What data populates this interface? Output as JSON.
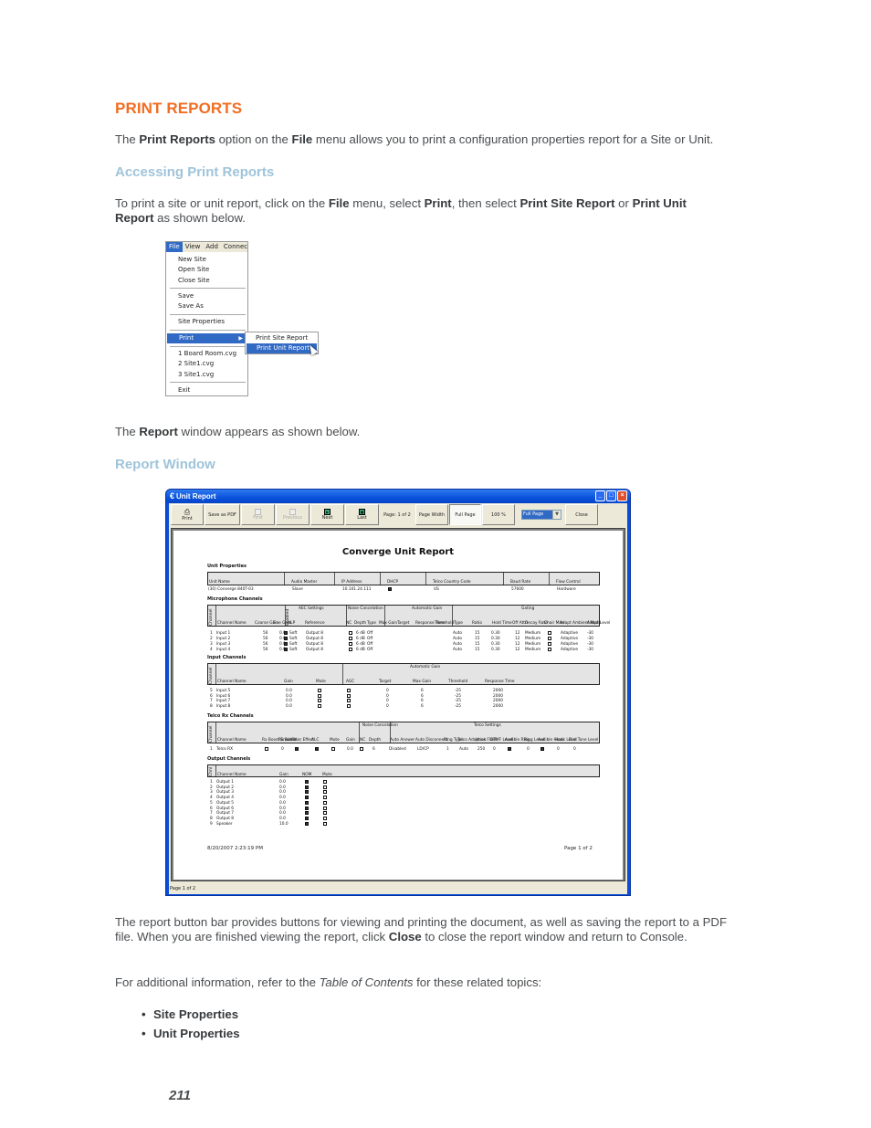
{
  "heading": "PRINT REPORTS",
  "intro": {
    "p1": "The ",
    "b1": "Print Reports",
    "p2": " option on the ",
    "b2": "File",
    "p3": " menu allows you to print a configuration properties report for a Site or Unit."
  },
  "section1": {
    "title": "Accessing Print Reports",
    "t1": "To print a site or unit report, click on the ",
    "b1": "File",
    "t2": " menu, select ",
    "b2": "Print",
    "t3": ", then select ",
    "b3": "Print Site Report",
    "t4": " or ",
    "b4": "Print Unit",
    "b5": "Report",
    "t5": " as shown below."
  },
  "file_menu": {
    "menubar": [
      "File",
      "View",
      "Add",
      "Connec"
    ],
    "groups": [
      [
        "New Site",
        "Open Site",
        "Close Site"
      ],
      [
        "Save",
        "Save As"
      ],
      [
        "Site Properties"
      ],
      [
        "Print"
      ],
      [
        "1 Board Room.cvg",
        "2 Site1.cvg",
        "3 Site1.cvg"
      ],
      [
        "Exit"
      ]
    ],
    "submenu": [
      "Print Site Report",
      "Print Unit Report"
    ],
    "highlighted_item": "Print",
    "highlighted_subitem": "Print Unit Report"
  },
  "report_caption": {
    "t1": "The ",
    "b1": "Report",
    "t2": " window appears as shown below."
  },
  "section2": {
    "title": "Report Window"
  },
  "report_window": {
    "title": "Unit Report",
    "toolbar": {
      "print": "Print",
      "save_pdf": "Save as PDF",
      "first": "First",
      "previous": "Previous",
      "next": "Next",
      "last": "Last",
      "page_indicator": "Page: 1 of 2",
      "page_width": "Page Width",
      "full_page": "Full Page",
      "zoom_percent": "100 %",
      "zoom_select": "Full Page",
      "close": "Close"
    },
    "status": "Page 1 of 2",
    "report": {
      "title": "Converge Unit Report",
      "unit_properties": {
        "label": "Unit Properties",
        "headers": [
          "Unit Name",
          "Audio Master",
          "IP Address",
          "DHCP",
          "Telco Country Code",
          "Baud Rate",
          "Flow Control"
        ],
        "row": [
          "(30) Converge 840T-03",
          "Slave",
          "10.101.24.111",
          "checked",
          "US",
          "57600",
          "Hardware"
        ]
      },
      "microphone_channels": {
        "label": "Microphone Channels",
        "group_headers": [
          "AEC Settings",
          "Noise Cancelation",
          "Automatic Gain",
          "Gating"
        ],
        "headers": [
          "Channel",
          "Channel Name",
          "Coarse Gain",
          "Fine Gain",
          "Enabled",
          "NLP",
          "Reference",
          "NC",
          "Depth",
          "Type",
          "Max Gain",
          "Target",
          "Response Time",
          "Threshold",
          "Type",
          "Ratio",
          "Hold Time",
          "Off Attn",
          "Decay Rate",
          "Chair Man",
          "Adapt Ambient Mode",
          "Adapt Level"
        ],
        "rows": [
          [
            "1",
            "Input 1",
            "56",
            "0.0",
            "on",
            "Soft",
            "Output 8",
            "off",
            "6 dB",
            "Off",
            "",
            "",
            "",
            "",
            "Auto",
            "15",
            "0.30",
            "12",
            "Medium",
            "off",
            "Adaptive",
            "-30"
          ],
          [
            "2",
            "Input 2",
            "56",
            "0.0",
            "on",
            "Soft",
            "Output 8",
            "off",
            "6 dB",
            "Off",
            "",
            "",
            "",
            "",
            "Auto",
            "15",
            "0.30",
            "12",
            "Medium",
            "off",
            "Adaptive",
            "-30"
          ],
          [
            "3",
            "Input 3",
            "56",
            "0.0",
            "on",
            "Soft",
            "Output 8",
            "off",
            "6 dB",
            "Off",
            "",
            "",
            "",
            "",
            "Auto",
            "15",
            "0.30",
            "12",
            "Medium",
            "off",
            "Adaptive",
            "-30"
          ],
          [
            "4",
            "Input 4",
            "56",
            "0.0",
            "on",
            "Soft",
            "Output 8",
            "off",
            "6 dB",
            "Off",
            "",
            "",
            "",
            "",
            "Auto",
            "15",
            "0.30",
            "12",
            "Medium",
            "off",
            "Adaptive",
            "-30"
          ]
        ]
      },
      "input_channels": {
        "label": "Input Channels",
        "group_header": "Automatic Gain",
        "headers": [
          "Channel",
          "Channel Name",
          "Gain",
          "Mute",
          "AGC",
          "Target",
          "Max Gain",
          "Threshold",
          "Response Time"
        ],
        "rows": [
          [
            "5",
            "Input 5",
            "0.0",
            "off",
            "off",
            "0",
            "6",
            "-25",
            "2000"
          ],
          [
            "6",
            "Input 6",
            "0.0",
            "off",
            "off",
            "0",
            "6",
            "-25",
            "2000"
          ],
          [
            "7",
            "Input 7",
            "0.0",
            "off",
            "off",
            "0",
            "6",
            "-25",
            "2000"
          ],
          [
            "8",
            "Input 8",
            "0.0",
            "off",
            "off",
            "0",
            "6",
            "-25",
            "2000"
          ]
        ]
      },
      "telco_rx_channels": {
        "label": "Telco Rx Channels",
        "group_headers": [
          "Noise Cancelation",
          "Telco Settings"
        ],
        "headers": [
          "Channel",
          "Channel Name",
          "Rx Boost Enabled",
          "Rx Boost",
          "Clear Effect",
          "ALC",
          "Mute",
          "Gain",
          "NC",
          "Depth",
          "Auto Answer",
          "Auto Disconnect",
          "Ring Type",
          "Telco Adaption",
          "Hook Flash",
          "DTMF Level",
          "Audible Ring",
          "Ring Level",
          "Audible Hook",
          "Hook Level",
          "Dial Tone Level"
        ],
        "rows": [
          [
            "1",
            "Telco RX",
            "off",
            "0",
            "on",
            "on",
            "off",
            "0.0",
            "off",
            "6",
            "Disabled",
            "LD/CP",
            "1",
            "Auto",
            "250",
            "0",
            "on",
            "0",
            "on",
            "0",
            "0"
          ]
        ]
      },
      "output_channels": {
        "label": "Output Channels",
        "headers": [
          "Chnl",
          "Channel Name",
          "Gain",
          "NOM",
          "Mute"
        ],
        "rows": [
          [
            "1",
            "Output 1",
            "0.0",
            "on",
            "off"
          ],
          [
            "2",
            "Output 2",
            "0.0",
            "on",
            "off"
          ],
          [
            "3",
            "Output 3",
            "0.0",
            "on",
            "off"
          ],
          [
            "4",
            "Output 4",
            "0.0",
            "on",
            "off"
          ],
          [
            "5",
            "Output 5",
            "0.0",
            "on",
            "off"
          ],
          [
            "6",
            "Output 6",
            "0.0",
            "on",
            "off"
          ],
          [
            "7",
            "Output 7",
            "0.0",
            "on",
            "off"
          ],
          [
            "8",
            "Output 8",
            "0.0",
            "on",
            "off"
          ],
          [
            "9",
            "Speaker",
            "10.0",
            "on",
            "off"
          ]
        ]
      },
      "footer_date": "8/20/2007 2:23:19 PM",
      "footer_page": "Page 1 of 2"
    }
  },
  "closing": {
    "t1": "The report button bar provides buttons for viewing and printing the document, as well as saving the report to a PDF",
    "t2": "file. When you are finished viewing the report, click ",
    "b1": "Close",
    "t3": " to close the report window and return to Console."
  },
  "related": {
    "t1": "For additional information, refer to the ",
    "i1": "Table of Contents",
    "t2": " for these related topics:",
    "items": [
      "Site Properties",
      "Unit Properties"
    ]
  },
  "page_number": "211"
}
